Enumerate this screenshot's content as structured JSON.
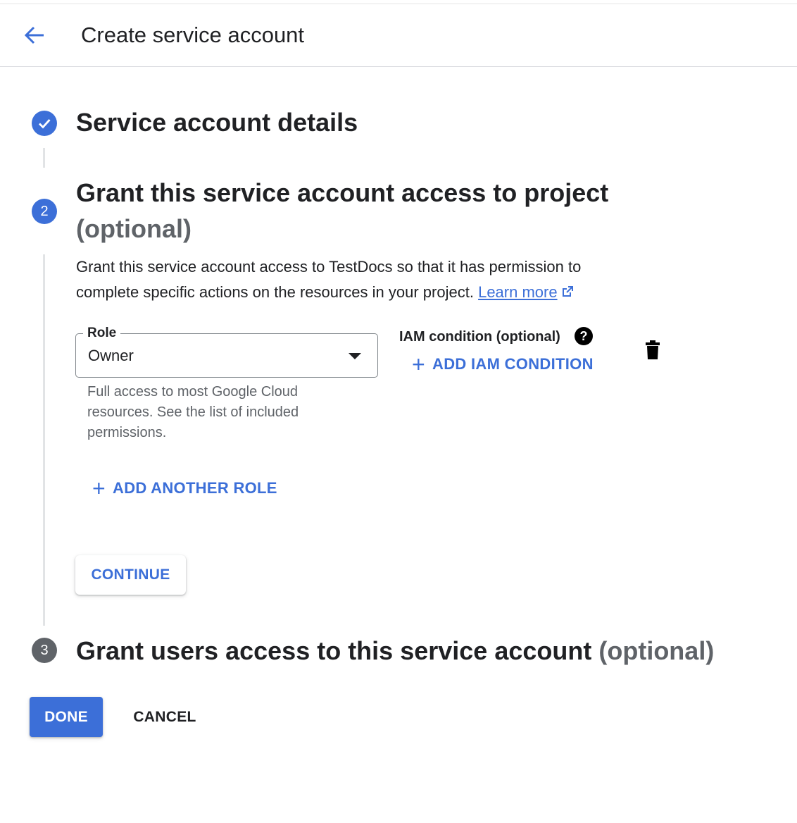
{
  "header": {
    "title": "Create service account"
  },
  "steps": [
    {
      "title": "Service account details",
      "status": "complete"
    },
    {
      "number": "2",
      "title": "Grant this service account access to project",
      "optional": "(optional)",
      "description": "Grant this service account access to TestDocs so that it has permission to complete specific actions on the resources in your project.",
      "learn_more": "Learn more",
      "role_label": "Role",
      "role_value": "Owner",
      "role_hint": "Full access to most Google Cloud resources. See the list of included permissions.",
      "iam_label": "IAM condition (optional)",
      "help_glyph": "?",
      "add_iam_label": "ADD IAM CONDITION",
      "add_role_label": "ADD ANOTHER ROLE",
      "continue_label": "CONTINUE"
    },
    {
      "number": "3",
      "title": "Grant users access to this service account",
      "optional": "(optional)"
    }
  ],
  "footer": {
    "done_label": "DONE",
    "cancel_label": "CANCEL"
  },
  "icons": {
    "back": "arrow-back-icon",
    "check": "check-icon",
    "external": "open-in-new-icon",
    "dropdown": "arrow-drop-down-icon",
    "help": "help-icon",
    "add": "plus-icon",
    "delete": "trash-icon"
  },
  "colors": {
    "accent": "#3c6fd8",
    "step_inactive": "#5f6368",
    "text": "#202124",
    "secondary_text": "#5f6368"
  }
}
